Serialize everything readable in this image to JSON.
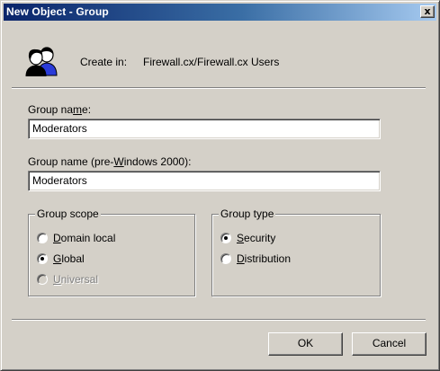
{
  "window": {
    "title": "New Object - Group",
    "close_glyph": "x",
    "titlebar_colors": [
      "#0a246a",
      "#a6caf0"
    ],
    "face_color": "#d4d0c8"
  },
  "header": {
    "icon": "group-users-icon",
    "create_in_label": "Create in:",
    "create_in_path": "Firewall.cx/Firewall.cx Users"
  },
  "fields": {
    "group_name_label_pre": "Group na",
    "group_name_label_key": "m",
    "group_name_label_post": "e:",
    "group_name_value": "Moderators",
    "group_name_pre2000_label_pre": "Group name (pre-",
    "group_name_pre2000_label_key": "W",
    "group_name_pre2000_label_post": "indows 2000):",
    "group_name_pre2000_value": "Moderators"
  },
  "group_scope": {
    "title": "Group scope",
    "options": [
      {
        "key": "D",
        "rest": "omain local",
        "checked": false,
        "disabled": false
      },
      {
        "key": "G",
        "rest": "lobal",
        "checked": true,
        "disabled": false
      },
      {
        "key": "U",
        "rest": "niversal",
        "checked": false,
        "disabled": true
      }
    ]
  },
  "group_type": {
    "title": "Group type",
    "options": [
      {
        "key": "S",
        "rest": "ecurity",
        "checked": true,
        "disabled": false
      },
      {
        "key": "D",
        "rest": "istribution",
        "checked": false,
        "disabled": false
      }
    ]
  },
  "buttons": {
    "ok": "OK",
    "cancel": "Cancel"
  }
}
